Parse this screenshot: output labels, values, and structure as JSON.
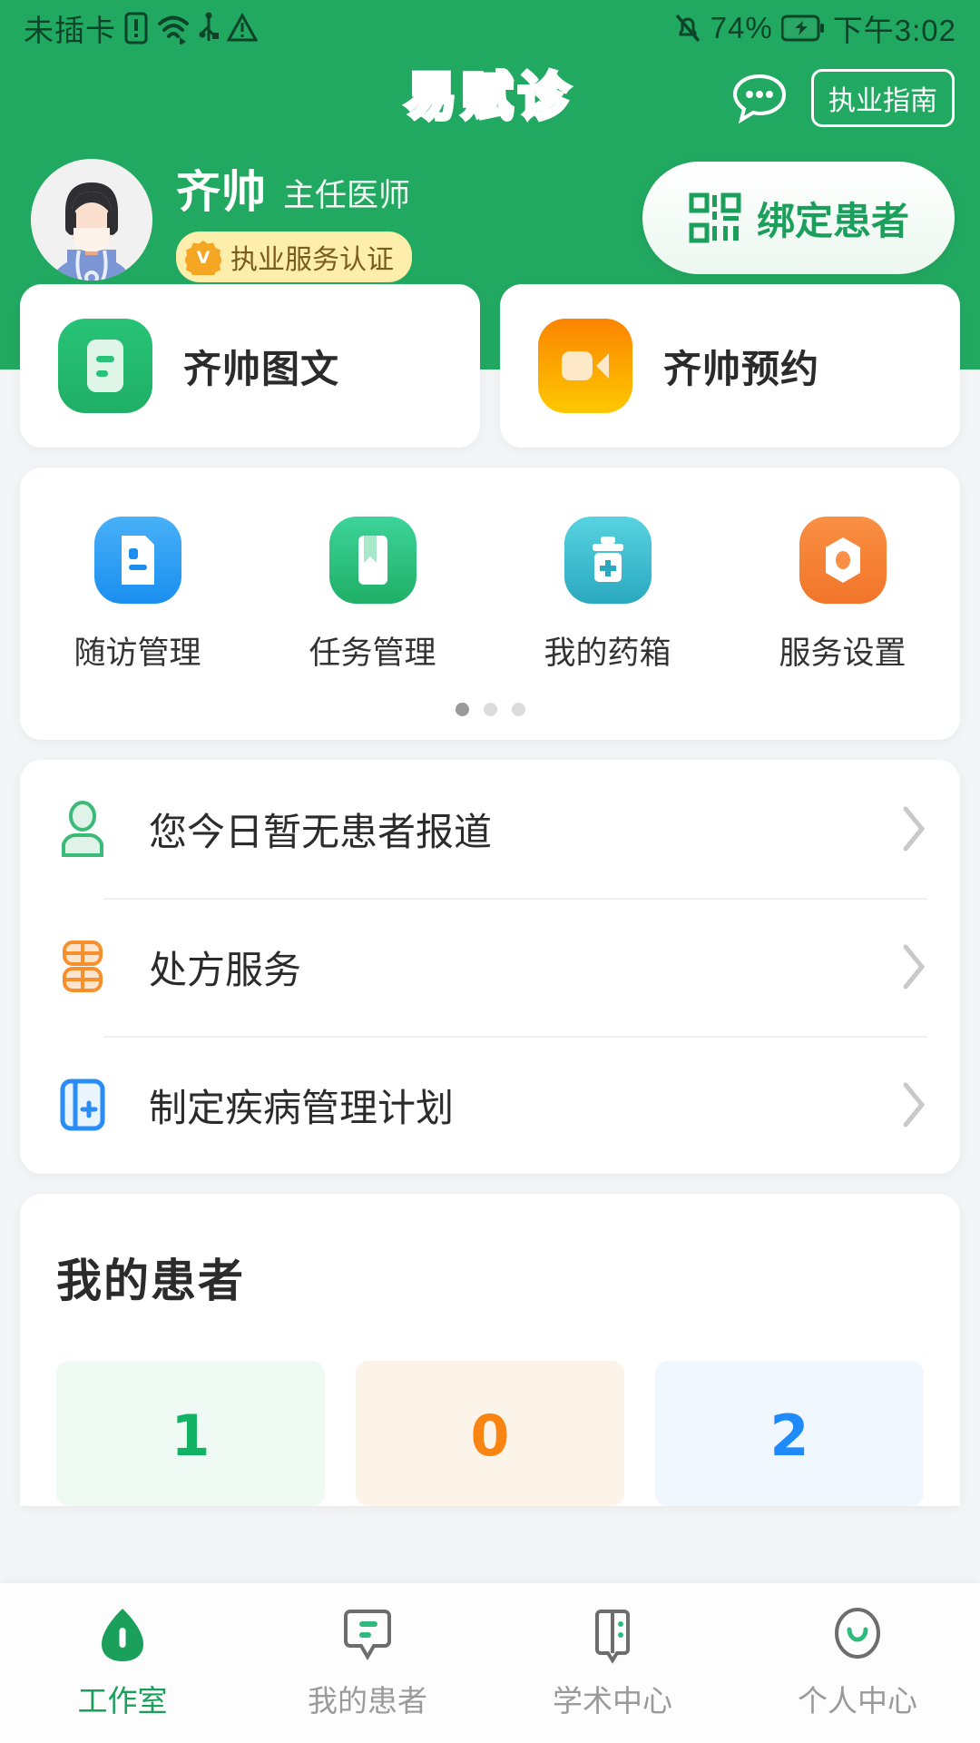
{
  "status_bar": {
    "carrier": "未插卡",
    "icons_left": [
      "sim-warning-icon",
      "wifi-icon",
      "usb-icon",
      "alert-triangle-icon"
    ],
    "mute_icon": "bell-muted-icon",
    "battery_percent": "74%",
    "battery_icon": "battery-charging-icon",
    "time": "下午3:02"
  },
  "header": {
    "brand": "易赋诊",
    "more_icon": "chat-dots-icon",
    "guide_button": "执业指南",
    "accent_green": "#22a961"
  },
  "profile": {
    "avatar_icon": "doctor-avatar",
    "name": "齐帅",
    "title": "主任医师",
    "cert_badge": "执业服务认证",
    "cert_icon": "verified-badge-icon",
    "cert_bg": "#fdeeab",
    "bind_button": {
      "label": "绑定患者",
      "icon": "qr-scan-icon",
      "color": "#1ba05c"
    }
  },
  "services": [
    {
      "label": "齐帅图文",
      "icon": "document-text-icon",
      "color": "#2ebd71"
    },
    {
      "label": "齐帅预约",
      "icon": "video-camera-icon",
      "color": "#f99500"
    }
  ],
  "quick_actions": {
    "items": [
      {
        "label": "随访管理",
        "icon": "followup-document-icon",
        "color": "#2196f3"
      },
      {
        "label": "任务管理",
        "icon": "bookmark-task-icon",
        "color": "#29c07f"
      },
      {
        "label": "我的药箱",
        "icon": "medical-kit-icon",
        "color": "#3ec2d0"
      },
      {
        "label": "服务设置",
        "icon": "service-settings-icon",
        "color": "#f3843c"
      }
    ],
    "pager": {
      "total": 3,
      "active": 1
    }
  },
  "list_rows": [
    {
      "label": "您今日暂无患者报道",
      "icon": "patient-person-icon",
      "color": "#3bbb77",
      "chevron": "chevron-right-icon"
    },
    {
      "label": "处方服务",
      "icon": "prescription-pills-icon",
      "color": "#f5902c",
      "chevron": "chevron-right-icon"
    },
    {
      "label": "制定疾病管理计划",
      "icon": "plan-book-plus-icon",
      "color": "#2a8cf5",
      "chevron": "chevron-right-icon"
    }
  ],
  "my_patients": {
    "title": "我的患者",
    "stats": [
      {
        "value": "1",
        "color": "#12b265",
        "bg": "#f0faf5"
      },
      {
        "value": "0",
        "color": "#fa8412",
        "bg": "#fdf4e9"
      },
      {
        "value": "2",
        "color": "#1f8bfa",
        "bg": "#f0f7fe"
      }
    ]
  },
  "bottom_nav": {
    "items": [
      {
        "label": "工作室",
        "icon": "workshop-icon",
        "active": true
      },
      {
        "label": "我的患者",
        "icon": "chat-lines-icon",
        "active": false
      },
      {
        "label": "学术中心",
        "icon": "open-book-icon",
        "active": false
      },
      {
        "label": "个人中心",
        "icon": "user-circle-icon",
        "active": false
      }
    ],
    "active_color": "#1ba05c",
    "inactive_color": "#9a9a9a"
  }
}
